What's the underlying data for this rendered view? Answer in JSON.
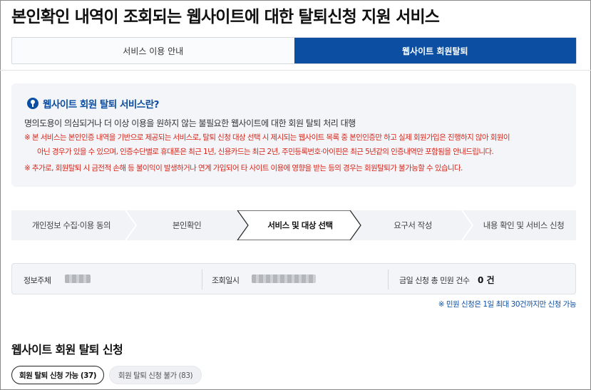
{
  "page": {
    "title": "본인확인 내역이 조회되는 웹사이트에 대한 탈퇴신청 지원 서비스"
  },
  "tabs": [
    {
      "label": "서비스 이용 안내",
      "active": false
    },
    {
      "label": "웹사이트 회원탈퇴",
      "active": true
    }
  ],
  "info": {
    "icon": "key-icon",
    "title": "웹사이트 회원 탈퇴 서비스란?",
    "description": "명의도용이 의심되거나 더 이상 이용을 원하지 않는 불필요한 웹사이트에 대한 회원 탈퇴 처리 대행",
    "note1_line1": "※ 본 서비스는 본인인증 내역을 기반으로 제공되는 서비스로, 탈퇴 신청 대상 선택 시 제시되는 웹사이트 목록 중 본인인증만 하고 실제 회원가입은 진행하지 않아 회원이",
    "note1_line2": "아닌 경우가 있을 수 있으며, 인증수단별로 휴대폰은 최근 1년, 신용카드는 최근 2년, 주민등록번호·아이핀은 최근 5년같의 인증내역만 포함됨을 안내드립니다.",
    "note2": "※ 추가로, 회원탈퇴 시 금전적 손해 등 불이익이 발생하거나 연계 가입되어 타 사이트 이용에 영향을 받는 등의 경우는 회원탈퇴가 불가능할 수 있습니다."
  },
  "steps": [
    {
      "label": "개인정보 수집·이용 동의",
      "active": false
    },
    {
      "label": "본인확인",
      "active": false
    },
    {
      "label": "서비스 및 대상 선택",
      "active": true
    },
    {
      "label": "요구서 작성",
      "active": false
    },
    {
      "label": "내용 확인 및 서비스 신청",
      "active": false
    }
  ],
  "summary": {
    "subject_label": "정보주체",
    "date_label": "조회일시",
    "count_label": "금일 신청 총 민원 건수",
    "count_value": "0 건"
  },
  "limit_note": "※ 민원 신청은 1일 최대 30건까지만 신청 가능",
  "section": {
    "title": "웹사이트 회원 탈퇴 신청"
  },
  "chips": {
    "available": "회원 탈퇴 신청 가능 (37)",
    "unavailable": "회원 탈퇴 신청 불가 (83)"
  },
  "colors": {
    "primary": "#0b4ea2",
    "warning": "#d7261b",
    "panel": "#f3f5f8"
  }
}
